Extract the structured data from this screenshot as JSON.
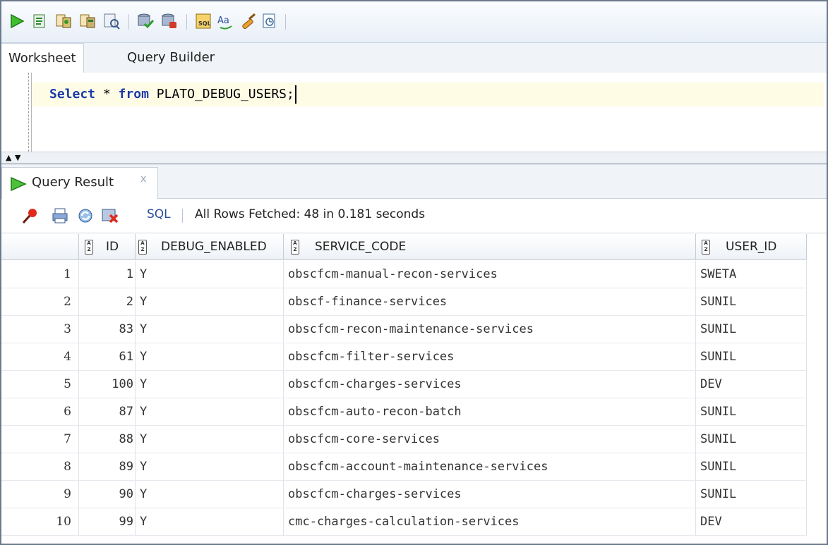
{
  "toolbar": {
    "icons": [
      "run-statement-icon",
      "run-script-icon",
      "autotrace-icon",
      "explain-plan-icon",
      "sql-tuning-icon",
      "commit-icon",
      "rollback-icon",
      "unshared-sql-icon",
      "to-upper-lower-icon",
      "clear-icon",
      "sql-history-icon"
    ]
  },
  "tabs": {
    "worksheet": "Worksheet",
    "query_builder": "Query Builder"
  },
  "editor": {
    "kw_select": "Select",
    "star": "*",
    "kw_from": "from",
    "table": "PLATO_DEBUG_USERS;"
  },
  "result_tab": {
    "label": "Query Result",
    "close": "x"
  },
  "result_toolbar": {
    "sql_label": "SQL",
    "status": "All Rows Fetched: 48 in 0.181 seconds"
  },
  "grid": {
    "columns": [
      "ID",
      "DEBUG_ENABLED",
      "SERVICE_CODE",
      "USER_ID"
    ],
    "rows": [
      {
        "n": "1",
        "id": "1",
        "debug": "Y",
        "service": "obscfcm-manual-recon-services",
        "user": "SWETA"
      },
      {
        "n": "2",
        "id": "2",
        "debug": "Y",
        "service": "obscf-finance-services",
        "user": "SUNIL"
      },
      {
        "n": "3",
        "id": "83",
        "debug": "Y",
        "service": "obscfcm-recon-maintenance-services",
        "user": "SUNIL"
      },
      {
        "n": "4",
        "id": "61",
        "debug": "Y",
        "service": "obscfcm-filter-services",
        "user": "SUNIL"
      },
      {
        "n": "5",
        "id": "100",
        "debug": "Y",
        "service": "obscfcm-charges-services",
        "user": "DEV"
      },
      {
        "n": "6",
        "id": "87",
        "debug": "Y",
        "service": "obscfcm-auto-recon-batch",
        "user": "SUNIL"
      },
      {
        "n": "7",
        "id": "88",
        "debug": "Y",
        "service": "obscfcm-core-services",
        "user": "SUNIL"
      },
      {
        "n": "8",
        "id": "89",
        "debug": "Y",
        "service": "obscfcm-account-maintenance-services",
        "user": "SUNIL"
      },
      {
        "n": "9",
        "id": "90",
        "debug": "Y",
        "service": "obscfcm-charges-services",
        "user": "SUNIL"
      },
      {
        "n": "10",
        "id": "99",
        "debug": "Y",
        "service": "cmc-charges-calculation-services",
        "user": "DEV"
      }
    ]
  }
}
